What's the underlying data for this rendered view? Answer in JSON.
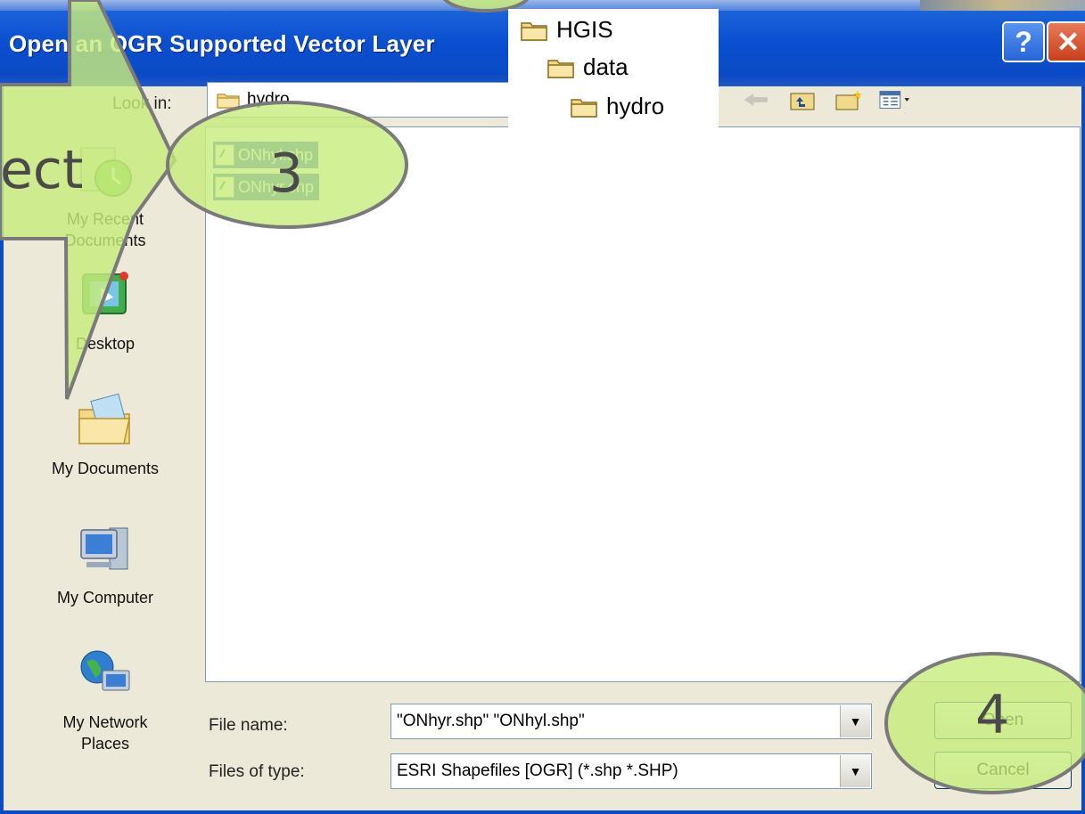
{
  "window": {
    "title": "Open an OGR Supported Vector Layer",
    "help_label": "?",
    "close_label": "✕"
  },
  "toolbar": {
    "look_in_label": "Look in:",
    "look_in_value": "hydro",
    "nav_icons": [
      "back-arrow-icon",
      "up-one-level-icon",
      "new-folder-icon",
      "view-menu-icon"
    ]
  },
  "places": [
    {
      "label": "My Recent\nDocuments",
      "icon": "recent-documents-icon"
    },
    {
      "label": "Desktop",
      "icon": "desktop-icon"
    },
    {
      "label": "My Documents",
      "icon": "my-documents-icon"
    },
    {
      "label": "My Computer",
      "icon": "my-computer-icon"
    },
    {
      "label": "My Network\nPlaces",
      "icon": "network-places-icon"
    }
  ],
  "files": [
    {
      "name": "ONhyl.shp"
    },
    {
      "name": "ONhyr.shp"
    }
  ],
  "form": {
    "file_name_label": "File name:",
    "file_name_value": "\"ONhyr.shp\" \"ONhyl.shp\"",
    "files_of_type_label": "Files of type:",
    "files_of_type_value": "ESRI Shapefiles [OGR] (*.shp *.SHP)",
    "open_label": "Open",
    "cancel_label": "Cancel"
  },
  "annotations": {
    "step3": "3",
    "step4": "4",
    "partial_word": "ect",
    "path_tree": [
      "HGIS",
      "data",
      "hydro"
    ],
    "highlight_color": "#c7ec7c",
    "outline_color": "#7a7a7a"
  }
}
